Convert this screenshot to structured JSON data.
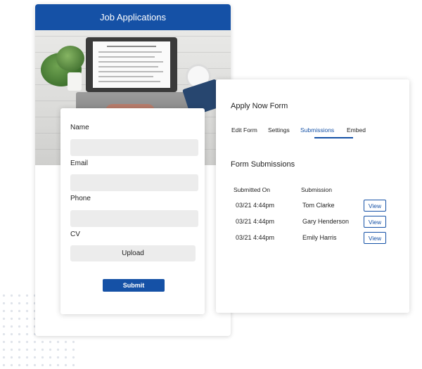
{
  "job_card": {
    "header_title": "Job Applications"
  },
  "form": {
    "fields": [
      {
        "label": "Name",
        "value": ""
      },
      {
        "label": "Email",
        "value": ""
      },
      {
        "label": "Phone",
        "value": ""
      },
      {
        "label": "CV"
      }
    ],
    "upload_label": "Upload",
    "submit_label": "Submit"
  },
  "submissions_card": {
    "title": "Apply Now Form",
    "tabs": [
      {
        "label": "Edit Form",
        "active": false
      },
      {
        "label": "Settings",
        "active": false
      },
      {
        "label": "Submissions",
        "active": true
      },
      {
        "label": "Embed",
        "active": false
      }
    ],
    "section_title": "Form Submissions",
    "columns": [
      "Submitted On",
      "Submission"
    ],
    "rows": [
      {
        "date": "03/21 4:44pm",
        "name": "Tom Clarke",
        "action": "View"
      },
      {
        "date": "03/21 4:44pm",
        "name": "Gary Henderson",
        "action": "View"
      },
      {
        "date": "03/21 4:44pm",
        "name": "Emily Harris",
        "action": "View"
      }
    ]
  },
  "colors": {
    "accent": "#1551a6",
    "input_bg": "#ececec"
  }
}
